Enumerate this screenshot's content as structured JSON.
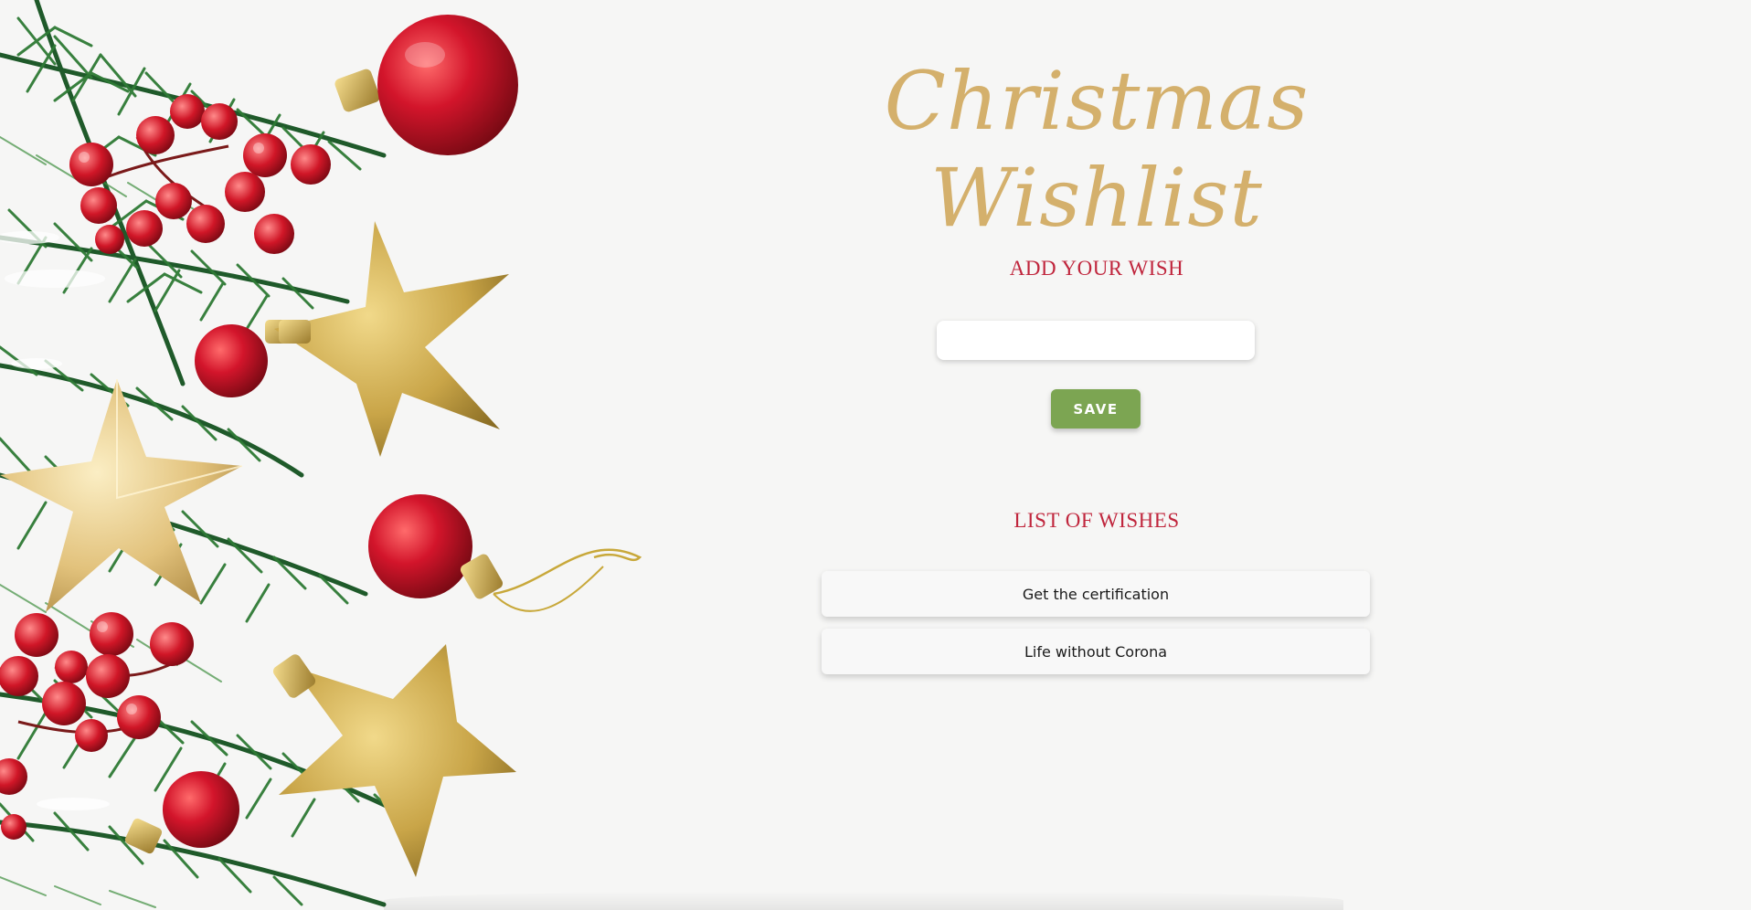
{
  "header": {
    "title": "Christmas Wishlist"
  },
  "add_section": {
    "heading": "ADD YOUR WISH",
    "input_value": "",
    "input_placeholder": "",
    "save_label": "SAVE"
  },
  "list_section": {
    "heading": "LIST OF WISHES",
    "items": [
      {
        "label": "Get the certification"
      },
      {
        "label": "Life without Corona"
      }
    ]
  },
  "decor": {
    "icons": [
      "fir-branch-icon",
      "red-bauble-icon",
      "gold-star-icon",
      "holly-berries-icon"
    ]
  },
  "colors": {
    "title": "#d4b06c",
    "heading": "#c0263d",
    "save_button": "#7ca552",
    "background": "#f6f6f5"
  }
}
